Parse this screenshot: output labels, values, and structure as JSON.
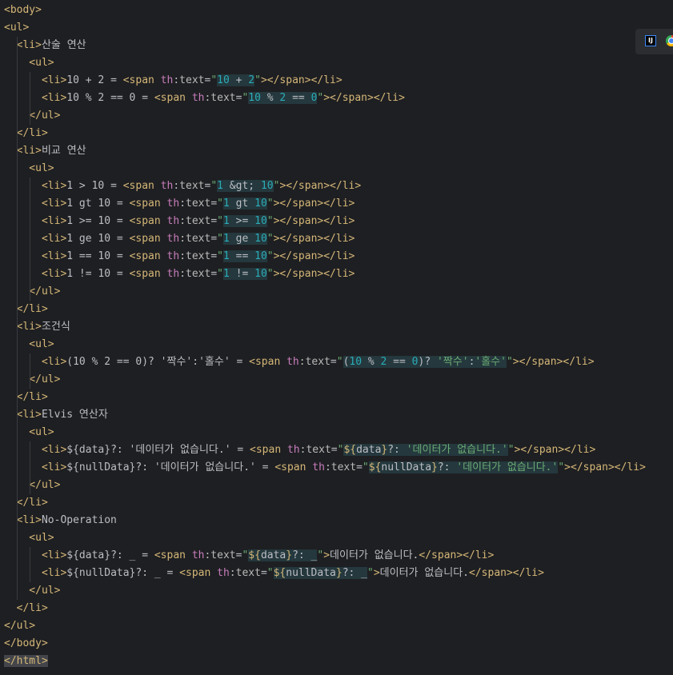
{
  "editor": {
    "lines": [
      [
        [
          "tag",
          "<body>"
        ]
      ],
      [
        [
          "tag",
          "<ul>"
        ]
      ],
      [
        [
          "tag",
          "  <li>"
        ],
        [
          "text",
          "산술 연산"
        ]
      ],
      [
        [
          "tag",
          "    <ul>"
        ]
      ],
      [
        [
          "tag",
          "      <li>"
        ],
        [
          "text",
          "10 + 2 = "
        ],
        [
          "tag",
          "<span "
        ],
        [
          "ns",
          "th"
        ],
        [
          "attr",
          ":text"
        ],
        [
          "eq",
          "="
        ],
        [
          "str",
          "\""
        ],
        [
          "hlnum",
          "10 + 2"
        ],
        [
          "str",
          "\""
        ],
        [
          "tag",
          "></span></li>"
        ]
      ],
      [
        [
          "tag",
          "      <li>"
        ],
        [
          "text",
          "10 % 2 == 0 = "
        ],
        [
          "tag",
          "<span "
        ],
        [
          "ns",
          "th"
        ],
        [
          "attr",
          ":text"
        ],
        [
          "eq",
          "="
        ],
        [
          "str",
          "\""
        ],
        [
          "hlnum",
          "10 % 2 == 0"
        ],
        [
          "str",
          "\""
        ],
        [
          "tag",
          "></span></li>"
        ]
      ],
      [
        [
          "tag",
          "    </ul>"
        ]
      ],
      [
        [
          "tag",
          "  </li>"
        ]
      ],
      [
        [
          "tag",
          "  <li>"
        ],
        [
          "text",
          "비교 연산"
        ]
      ],
      [
        [
          "tag",
          "    <ul>"
        ]
      ],
      [
        [
          "tag",
          "      <li>"
        ],
        [
          "text",
          "1 > 10 = "
        ],
        [
          "tag",
          "<span "
        ],
        [
          "ns",
          "th"
        ],
        [
          "attr",
          ":text"
        ],
        [
          "eq",
          "="
        ],
        [
          "str",
          "\""
        ],
        [
          "hlnum",
          "1 &gt; 10"
        ],
        [
          "str",
          "\""
        ],
        [
          "tag",
          "></span></li>"
        ]
      ],
      [
        [
          "tag",
          "      <li>"
        ],
        [
          "text",
          "1 gt 10 = "
        ],
        [
          "tag",
          "<span "
        ],
        [
          "ns",
          "th"
        ],
        [
          "attr",
          ":text"
        ],
        [
          "eq",
          "="
        ],
        [
          "str",
          "\""
        ],
        [
          "hlnum",
          "1 gt 10"
        ],
        [
          "str",
          "\""
        ],
        [
          "tag",
          "></span></li>"
        ]
      ],
      [
        [
          "tag",
          "      <li>"
        ],
        [
          "text",
          "1 >= 10 = "
        ],
        [
          "tag",
          "<span "
        ],
        [
          "ns",
          "th"
        ],
        [
          "attr",
          ":text"
        ],
        [
          "eq",
          "="
        ],
        [
          "str",
          "\""
        ],
        [
          "hlnum",
          "1 >= 10"
        ],
        [
          "str",
          "\""
        ],
        [
          "tag",
          "></span></li>"
        ]
      ],
      [
        [
          "tag",
          "      <li>"
        ],
        [
          "text",
          "1 ge 10 = "
        ],
        [
          "tag",
          "<span "
        ],
        [
          "ns",
          "th"
        ],
        [
          "attr",
          ":text"
        ],
        [
          "eq",
          "="
        ],
        [
          "str",
          "\""
        ],
        [
          "hlnum",
          "1 ge 10"
        ],
        [
          "str",
          "\""
        ],
        [
          "tag",
          "></span></li>"
        ]
      ],
      [
        [
          "tag",
          "      <li>"
        ],
        [
          "text",
          "1 == 10 = "
        ],
        [
          "tag",
          "<span "
        ],
        [
          "ns",
          "th"
        ],
        [
          "attr",
          ":text"
        ],
        [
          "eq",
          "="
        ],
        [
          "str",
          "\""
        ],
        [
          "hlnum",
          "1 == 10"
        ],
        [
          "str",
          "\""
        ],
        [
          "tag",
          "></span></li>"
        ]
      ],
      [
        [
          "tag",
          "      <li>"
        ],
        [
          "text",
          "1 != 10 = "
        ],
        [
          "tag",
          "<span "
        ],
        [
          "ns",
          "th"
        ],
        [
          "attr",
          ":text"
        ],
        [
          "eq",
          "="
        ],
        [
          "str",
          "\""
        ],
        [
          "hlnum",
          "1 != 10"
        ],
        [
          "str",
          "\""
        ],
        [
          "tag",
          "></span></li>"
        ]
      ],
      [
        [
          "tag",
          "    </ul>"
        ]
      ],
      [
        [
          "tag",
          "  </li>"
        ]
      ],
      [
        [
          "tag",
          "  <li>"
        ],
        [
          "text",
          "조건식"
        ]
      ],
      [
        [
          "tag",
          "    <ul>"
        ]
      ],
      [
        [
          "tag",
          "      <li>"
        ],
        [
          "text",
          "(10 % 2 == 0)? '짝수':'홀수' = "
        ],
        [
          "tag",
          "<span "
        ],
        [
          "ns",
          "th"
        ],
        [
          "attr",
          ":text"
        ],
        [
          "eq",
          "="
        ],
        [
          "str",
          "\""
        ],
        [
          "hlmix",
          "(10 % 2 == 0)? '짝수':'홀수'"
        ],
        [
          "str",
          "\""
        ],
        [
          "tag",
          "></span></li>"
        ]
      ],
      [
        [
          "tag",
          "    </ul>"
        ]
      ],
      [
        [
          "tag",
          "  </li>"
        ]
      ],
      [
        [
          "tag",
          "  <li>"
        ],
        [
          "text",
          "Elvis 연산자"
        ]
      ],
      [
        [
          "tag",
          "    <ul>"
        ]
      ],
      [
        [
          "tag",
          "      <li>"
        ],
        [
          "text",
          "${data}?: '데이터가 없습니다.' = "
        ],
        [
          "tag",
          "<span "
        ],
        [
          "ns",
          "th"
        ],
        [
          "attr",
          ":text"
        ],
        [
          "eq",
          "="
        ],
        [
          "str",
          "\""
        ],
        [
          "hlmix",
          "${data}?: '데이터가 없습니다.'"
        ],
        [
          "str",
          "\""
        ],
        [
          "tag",
          "></span></li>"
        ]
      ],
      [
        [
          "tag",
          "      <li>"
        ],
        [
          "text",
          "${nullData}?: '데이터가 없습니다.' = "
        ],
        [
          "tag",
          "<span "
        ],
        [
          "ns",
          "th"
        ],
        [
          "attr",
          ":text"
        ],
        [
          "eq",
          "="
        ],
        [
          "str",
          "\""
        ],
        [
          "hlmix",
          "${nullData}?: '데이터가 없습니다.'"
        ],
        [
          "str",
          "\""
        ],
        [
          "tag",
          "></span></li>"
        ]
      ],
      [
        [
          "tag",
          "    </ul>"
        ]
      ],
      [
        [
          "tag",
          "  </li>"
        ]
      ],
      [
        [
          "tag",
          "  <li>"
        ],
        [
          "text",
          "No-Operation"
        ]
      ],
      [
        [
          "tag",
          "    <ul>"
        ]
      ],
      [
        [
          "tag",
          "      <li>"
        ],
        [
          "text",
          "${data}?: _ = "
        ],
        [
          "tag",
          "<span "
        ],
        [
          "ns",
          "th"
        ],
        [
          "attr",
          ":text"
        ],
        [
          "eq",
          "="
        ],
        [
          "str",
          "\""
        ],
        [
          "hlmix",
          "${data}?: _"
        ],
        [
          "str",
          "\""
        ],
        [
          "tag",
          ">"
        ],
        [
          "text",
          "데이터가 없습니다."
        ],
        [
          "tag",
          "</span></li>"
        ]
      ],
      [
        [
          "tag",
          "      <li>"
        ],
        [
          "text",
          "${nullData}?: _ = "
        ],
        [
          "tag",
          "<span "
        ],
        [
          "ns",
          "th"
        ],
        [
          "attr",
          ":text"
        ],
        [
          "eq",
          "="
        ],
        [
          "str",
          "\""
        ],
        [
          "hlmix",
          "${nullData}?: _"
        ],
        [
          "str",
          "\""
        ],
        [
          "tag",
          ">"
        ],
        [
          "text",
          "데이터가 없습니다."
        ],
        [
          "tag",
          "</span></li>"
        ]
      ],
      [
        [
          "tag",
          "    </ul>"
        ]
      ],
      [
        [
          "tag",
          "  </li>"
        ]
      ],
      [
        [
          "tag",
          "</ul>"
        ]
      ],
      [
        [
          "tag",
          "</body>"
        ]
      ],
      [
        [
          "htmlhl",
          "</html>"
        ]
      ]
    ]
  },
  "plugins": {
    "ij_label": "IJ"
  },
  "colors": {
    "background": "#1e1f22",
    "tag": "#d5b778",
    "string": "#6aab73",
    "number": "#2aacb8",
    "namespace": "#c77dbb",
    "text": "#bcbec4"
  }
}
